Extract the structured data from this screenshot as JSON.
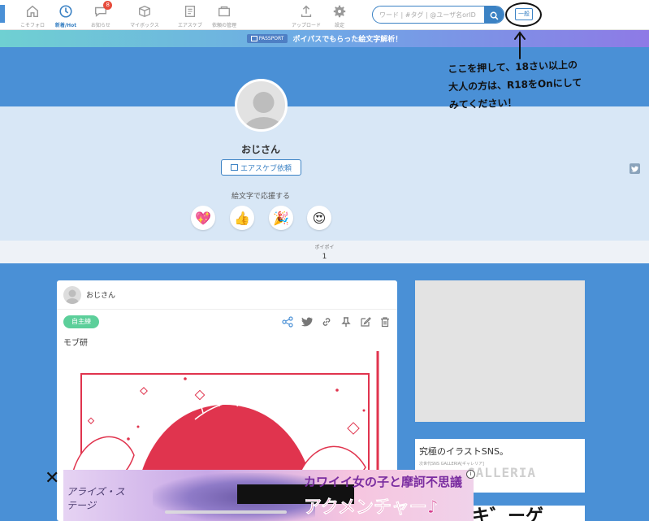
{
  "header": {
    "nav": [
      {
        "label": "こそフォロ",
        "icon": "home-icon"
      },
      {
        "label": "新着/Hot",
        "icon": "clock-icon"
      },
      {
        "label": "お知らせ",
        "icon": "notification-icon",
        "badge": "8"
      },
      {
        "label": "マイボックス",
        "icon": "box-icon"
      },
      {
        "label": "エアスケブ",
        "icon": "skeb-icon"
      },
      {
        "label": "依頼の管理",
        "icon": "request-icon"
      },
      {
        "label": "アップロード",
        "icon": "upload-icon"
      },
      {
        "label": "設定",
        "icon": "gear-icon"
      }
    ],
    "active_nav": "新着/Hot",
    "search": {
      "placeholder": "ワード | #タグ | @ユーザ名orID"
    },
    "mode_button": "一般"
  },
  "passport": {
    "badge": "PASSPORT",
    "text": "ポイパスでもらった絵文字解析！"
  },
  "annotation": {
    "lines": [
      "ここを押して、18さい以上の",
      "大人の方は、R18をOnにして",
      "みてください！"
    ]
  },
  "profile": {
    "name": "おじさん",
    "skeb_button": "エアスケブ依頼",
    "cheer_label": "絵文字で応援する",
    "emojis": [
      "💖",
      "👍",
      "🎉",
      "😍"
    ],
    "stats_label": "ポイポイ",
    "stats_value": "1"
  },
  "post": {
    "user": "おじさん",
    "tag": "自主練",
    "title": "モブ研"
  },
  "sidebar": {
    "ad_title": "究極のイラストSNS。",
    "ad_sub": "次世代SNS GALLERIA[ギャレリア]",
    "ad_logo": "GALLERIA",
    "ad_bottom_text": "キ゛ーゲ"
  },
  "bottom_ad": {
    "logo": "アライズ・ステージ",
    "copy1": "カワイイ女の子と摩訶不思議",
    "copy2": "アクメンチャー♪",
    "close": "✕",
    "info": "i"
  },
  "colors": {
    "accent": "#3b82c4",
    "bg_blue": "#4a90d6",
    "tag_green": "#5ccf9a",
    "art_red": "#e0344e"
  }
}
